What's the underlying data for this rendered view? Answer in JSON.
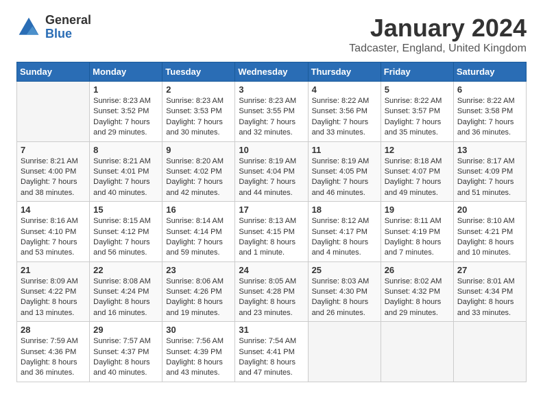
{
  "header": {
    "logo_general": "General",
    "logo_blue": "Blue",
    "title": "January 2024",
    "location": "Tadcaster, England, United Kingdom"
  },
  "days_of_week": [
    "Sunday",
    "Monday",
    "Tuesday",
    "Wednesday",
    "Thursday",
    "Friday",
    "Saturday"
  ],
  "weeks": [
    [
      {
        "num": "",
        "lines": []
      },
      {
        "num": "1",
        "lines": [
          "Sunrise: 8:23 AM",
          "Sunset: 3:52 PM",
          "Daylight: 7 hours",
          "and 29 minutes."
        ]
      },
      {
        "num": "2",
        "lines": [
          "Sunrise: 8:23 AM",
          "Sunset: 3:53 PM",
          "Daylight: 7 hours",
          "and 30 minutes."
        ]
      },
      {
        "num": "3",
        "lines": [
          "Sunrise: 8:23 AM",
          "Sunset: 3:55 PM",
          "Daylight: 7 hours",
          "and 32 minutes."
        ]
      },
      {
        "num": "4",
        "lines": [
          "Sunrise: 8:22 AM",
          "Sunset: 3:56 PM",
          "Daylight: 7 hours",
          "and 33 minutes."
        ]
      },
      {
        "num": "5",
        "lines": [
          "Sunrise: 8:22 AM",
          "Sunset: 3:57 PM",
          "Daylight: 7 hours",
          "and 35 minutes."
        ]
      },
      {
        "num": "6",
        "lines": [
          "Sunrise: 8:22 AM",
          "Sunset: 3:58 PM",
          "Daylight: 7 hours",
          "and 36 minutes."
        ]
      }
    ],
    [
      {
        "num": "7",
        "lines": [
          "Sunrise: 8:21 AM",
          "Sunset: 4:00 PM",
          "Daylight: 7 hours",
          "and 38 minutes."
        ]
      },
      {
        "num": "8",
        "lines": [
          "Sunrise: 8:21 AM",
          "Sunset: 4:01 PM",
          "Daylight: 7 hours",
          "and 40 minutes."
        ]
      },
      {
        "num": "9",
        "lines": [
          "Sunrise: 8:20 AM",
          "Sunset: 4:02 PM",
          "Daylight: 7 hours",
          "and 42 minutes."
        ]
      },
      {
        "num": "10",
        "lines": [
          "Sunrise: 8:19 AM",
          "Sunset: 4:04 PM",
          "Daylight: 7 hours",
          "and 44 minutes."
        ]
      },
      {
        "num": "11",
        "lines": [
          "Sunrise: 8:19 AM",
          "Sunset: 4:05 PM",
          "Daylight: 7 hours",
          "and 46 minutes."
        ]
      },
      {
        "num": "12",
        "lines": [
          "Sunrise: 8:18 AM",
          "Sunset: 4:07 PM",
          "Daylight: 7 hours",
          "and 49 minutes."
        ]
      },
      {
        "num": "13",
        "lines": [
          "Sunrise: 8:17 AM",
          "Sunset: 4:09 PM",
          "Daylight: 7 hours",
          "and 51 minutes."
        ]
      }
    ],
    [
      {
        "num": "14",
        "lines": [
          "Sunrise: 8:16 AM",
          "Sunset: 4:10 PM",
          "Daylight: 7 hours",
          "and 53 minutes."
        ]
      },
      {
        "num": "15",
        "lines": [
          "Sunrise: 8:15 AM",
          "Sunset: 4:12 PM",
          "Daylight: 7 hours",
          "and 56 minutes."
        ]
      },
      {
        "num": "16",
        "lines": [
          "Sunrise: 8:14 AM",
          "Sunset: 4:14 PM",
          "Daylight: 7 hours",
          "and 59 minutes."
        ]
      },
      {
        "num": "17",
        "lines": [
          "Sunrise: 8:13 AM",
          "Sunset: 4:15 PM",
          "Daylight: 8 hours",
          "and 1 minute."
        ]
      },
      {
        "num": "18",
        "lines": [
          "Sunrise: 8:12 AM",
          "Sunset: 4:17 PM",
          "Daylight: 8 hours",
          "and 4 minutes."
        ]
      },
      {
        "num": "19",
        "lines": [
          "Sunrise: 8:11 AM",
          "Sunset: 4:19 PM",
          "Daylight: 8 hours",
          "and 7 minutes."
        ]
      },
      {
        "num": "20",
        "lines": [
          "Sunrise: 8:10 AM",
          "Sunset: 4:21 PM",
          "Daylight: 8 hours",
          "and 10 minutes."
        ]
      }
    ],
    [
      {
        "num": "21",
        "lines": [
          "Sunrise: 8:09 AM",
          "Sunset: 4:22 PM",
          "Daylight: 8 hours",
          "and 13 minutes."
        ]
      },
      {
        "num": "22",
        "lines": [
          "Sunrise: 8:08 AM",
          "Sunset: 4:24 PM",
          "Daylight: 8 hours",
          "and 16 minutes."
        ]
      },
      {
        "num": "23",
        "lines": [
          "Sunrise: 8:06 AM",
          "Sunset: 4:26 PM",
          "Daylight: 8 hours",
          "and 19 minutes."
        ]
      },
      {
        "num": "24",
        "lines": [
          "Sunrise: 8:05 AM",
          "Sunset: 4:28 PM",
          "Daylight: 8 hours",
          "and 23 minutes."
        ]
      },
      {
        "num": "25",
        "lines": [
          "Sunrise: 8:03 AM",
          "Sunset: 4:30 PM",
          "Daylight: 8 hours",
          "and 26 minutes."
        ]
      },
      {
        "num": "26",
        "lines": [
          "Sunrise: 8:02 AM",
          "Sunset: 4:32 PM",
          "Daylight: 8 hours",
          "and 29 minutes."
        ]
      },
      {
        "num": "27",
        "lines": [
          "Sunrise: 8:01 AM",
          "Sunset: 4:34 PM",
          "Daylight: 8 hours",
          "and 33 minutes."
        ]
      }
    ],
    [
      {
        "num": "28",
        "lines": [
          "Sunrise: 7:59 AM",
          "Sunset: 4:36 PM",
          "Daylight: 8 hours",
          "and 36 minutes."
        ]
      },
      {
        "num": "29",
        "lines": [
          "Sunrise: 7:57 AM",
          "Sunset: 4:37 PM",
          "Daylight: 8 hours",
          "and 40 minutes."
        ]
      },
      {
        "num": "30",
        "lines": [
          "Sunrise: 7:56 AM",
          "Sunset: 4:39 PM",
          "Daylight: 8 hours",
          "and 43 minutes."
        ]
      },
      {
        "num": "31",
        "lines": [
          "Sunrise: 7:54 AM",
          "Sunset: 4:41 PM",
          "Daylight: 8 hours",
          "and 47 minutes."
        ]
      },
      {
        "num": "",
        "lines": []
      },
      {
        "num": "",
        "lines": []
      },
      {
        "num": "",
        "lines": []
      }
    ]
  ]
}
